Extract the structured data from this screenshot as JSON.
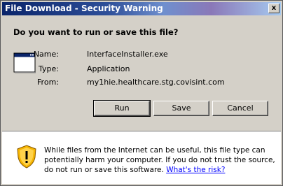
{
  "window": {
    "title": "File Download - Security Warning",
    "close_glyph": "x"
  },
  "question": "Do you want to run or save this file?",
  "file": {
    "name_label": "Name:",
    "name_value": "InterfaceInstaller.exe",
    "type_label": "Type:",
    "type_value": "Application",
    "from_label": "From:",
    "from_value": "my1hie.healthcare.stg.covisint.com"
  },
  "buttons": {
    "run": "Run",
    "save": "Save",
    "cancel": "Cancel"
  },
  "warning": {
    "text": "While files from the Internet can be useful, this file type can potentially harm your computer. If you do not trust the source, do not run or save this software. ",
    "link": "What's the risk?"
  },
  "colors": {
    "titlebar_start": "#0a246a",
    "titlebar_end": "#a6caf0",
    "dialog_bg": "#d4d0c8",
    "link": "#0000ff"
  }
}
